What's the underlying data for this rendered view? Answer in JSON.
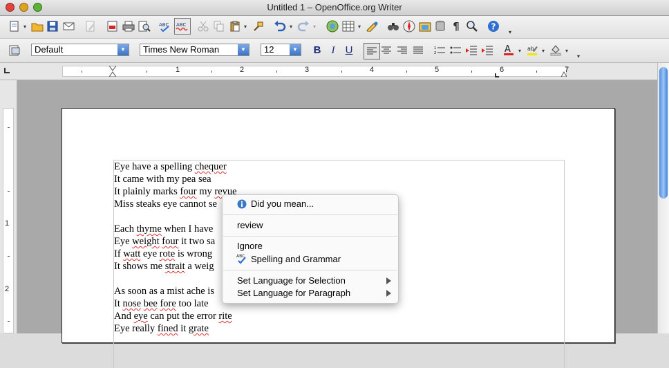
{
  "window": {
    "title": "Untitled 1 – OpenOffice.org Writer",
    "traffic_light_colors": {
      "close": "#e0443e",
      "minimize": "#dea123",
      "zoom": "#5db134"
    }
  },
  "toolbar_standard": {
    "icons": [
      "new-document-icon",
      "open-folder-icon",
      "save-icon",
      "email-icon",
      "edit-file-icon",
      "export-pdf-icon",
      "print-icon",
      "page-preview-icon",
      "spellcheck-icon",
      "autospellcheck-icon",
      "cut-icon",
      "copy-icon",
      "paste-icon",
      "clone-format-icon",
      "undo-icon",
      "redo-icon",
      "navigator-icon",
      "table-icon",
      "draw-functions-icon",
      "find-replace-icon",
      "navigator-compass-icon",
      "gallery-icon",
      "data-sources-icon",
      "formatting-marks-icon",
      "zoom-icon",
      "help-icon"
    ]
  },
  "toolbar_formatting": {
    "paragraph_style": "Default",
    "font_name": "Times New Roman",
    "font_size": "12",
    "bold_label": "B",
    "italic_label": "I",
    "underline_label": "U",
    "accent_color": "#3b73c7"
  },
  "ruler": {
    "labels": [
      "1",
      "2",
      "3",
      "4",
      "5",
      "6",
      "7"
    ]
  },
  "vertical_ruler": {
    "labels": [
      "1",
      "2"
    ]
  },
  "document": {
    "lines": [
      {
        "parts": [
          {
            "t": "Eye have a spelling "
          },
          {
            "t": "chequer",
            "err": true
          }
        ]
      },
      {
        "parts": [
          {
            "t": "It came with my pea sea"
          }
        ]
      },
      {
        "parts": [
          {
            "t": "It plainly marks "
          },
          {
            "t": "four",
            "err": true
          },
          {
            "t": " my "
          },
          {
            "t": "revue",
            "err": true
          }
        ]
      },
      {
        "parts": [
          {
            "t": "Miss steaks eye cannot se"
          }
        ]
      },
      {
        "parts": [
          {
            "t": ""
          }
        ]
      },
      {
        "parts": [
          {
            "t": "Each "
          },
          {
            "t": "thyme",
            "err": true
          },
          {
            "t": " when I have"
          }
        ]
      },
      {
        "parts": [
          {
            "t": "Eye "
          },
          {
            "t": "weight",
            "err": true
          },
          {
            "t": " "
          },
          {
            "t": "four",
            "err": true
          },
          {
            "t": " it two sa"
          }
        ]
      },
      {
        "parts": [
          {
            "t": "If "
          },
          {
            "t": "watt",
            "err": true
          },
          {
            "t": " eye "
          },
          {
            "t": "rote",
            "err": true
          },
          {
            "t": " is wrong"
          }
        ]
      },
      {
        "parts": [
          {
            "t": "It shows me "
          },
          {
            "t": "strait",
            "err": true
          },
          {
            "t": " a weig"
          }
        ]
      },
      {
        "parts": [
          {
            "t": ""
          }
        ]
      },
      {
        "parts": [
          {
            "t": "As soon as a mist ache is"
          }
        ]
      },
      {
        "parts": [
          {
            "t": "It "
          },
          {
            "t": "nose",
            "err": true
          },
          {
            "t": " "
          },
          {
            "t": "bee",
            "err": true
          },
          {
            "t": " "
          },
          {
            "t": "fore",
            "err": true
          },
          {
            "t": " too late"
          }
        ]
      },
      {
        "parts": [
          {
            "t": "And "
          },
          {
            "t": "eye",
            "err": true
          },
          {
            "t": " can put the error "
          },
          {
            "t": "rite",
            "err": true
          }
        ]
      },
      {
        "parts": [
          {
            "t": "Eye really "
          },
          {
            "t": "fined",
            "err": true
          },
          {
            "t": " it "
          },
          {
            "t": "grate",
            "err": true
          }
        ]
      }
    ],
    "error_underline_color": "#e03030"
  },
  "context_menu": {
    "header": "Did you mean...",
    "suggestion": "review",
    "ignore": "Ignore",
    "spelling_grammar": "Spelling and Grammar",
    "spelling_grammar_icon_text": "ABC",
    "set_language_selection": "Set Language for Selection",
    "set_language_paragraph": "Set Language for Paragraph"
  }
}
